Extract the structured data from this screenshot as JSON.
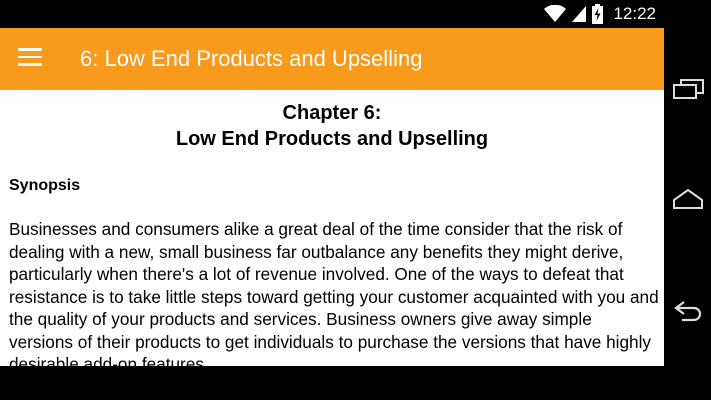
{
  "status_bar": {
    "time": "12:22",
    "icons": [
      "wifi-icon",
      "cell-signal-icon",
      "battery-charging-icon"
    ]
  },
  "app_bar": {
    "title": "6: Low End Products and Upselling",
    "menu_icon": "hamburger-menu-icon",
    "background_color": "#f89a1c"
  },
  "content": {
    "heading_line1": "Chapter 6:",
    "heading_line2": "Low End Products and Upselling",
    "section_label": "Synopsis",
    "body": "Businesses and consumers alike a great deal of the time consider that the risk of dealing with a new, small business far outbalance any benefits they might derive, particularly when there's a lot of revenue involved. One of the ways to defeat that resistance is to take little steps toward getting your customer acquainted with you and the quality of your products and services. Business owners give away simple versions of their products to get individuals to purchase the versions that have highly desirable add-on features."
  },
  "nav_bar": {
    "buttons": [
      "recent-apps-icon",
      "home-icon",
      "back-icon"
    ]
  }
}
